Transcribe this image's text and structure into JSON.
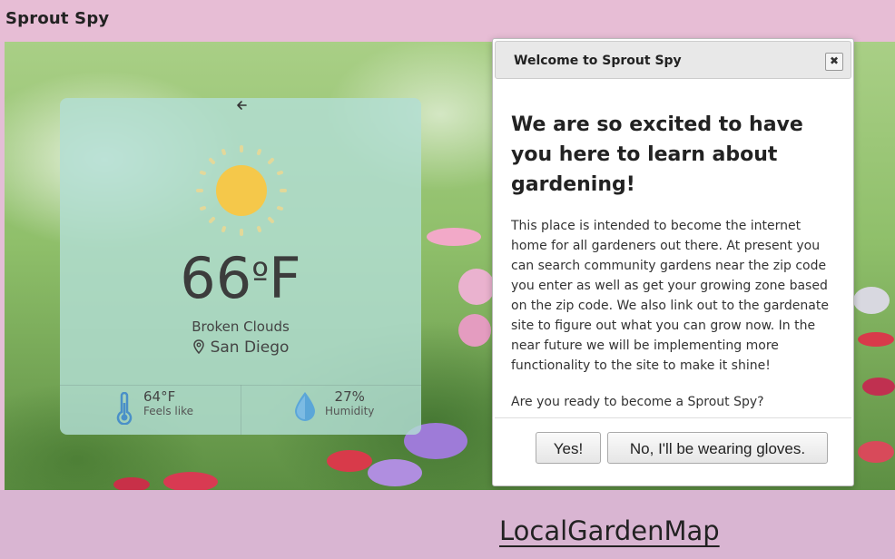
{
  "header": {
    "brand": "Sprout Spy"
  },
  "weather": {
    "temperature": "66",
    "unit": "F",
    "condition": "Broken Clouds",
    "city": "San Diego",
    "feels_like": {
      "value": "64°F",
      "label": "Feels like"
    },
    "humidity": {
      "value": "27%",
      "label": "Humidity"
    }
  },
  "modal": {
    "title": "Welcome to Sprout Spy",
    "heading": "We are so excited to have you here to learn about gardening!",
    "body": "This place is intended to become the internet home for all gardeners out there. At present you can search community gardens near the zip code you enter as well as get your growing zone based on the zip code. We also link out to the gardenate site to figure out what you can grow now. In the near future we will be implementing more functionality to the site to make it shine!",
    "question": "Are you ready to become a Sprout Spy?",
    "yes_label": "Yes!",
    "no_label": "No, I'll be wearing gloves."
  },
  "footer": {
    "map_link": "LocalGardenMap"
  },
  "colors": {
    "accent_blue": "#4a90c8",
    "sun": "#f5c84a"
  }
}
